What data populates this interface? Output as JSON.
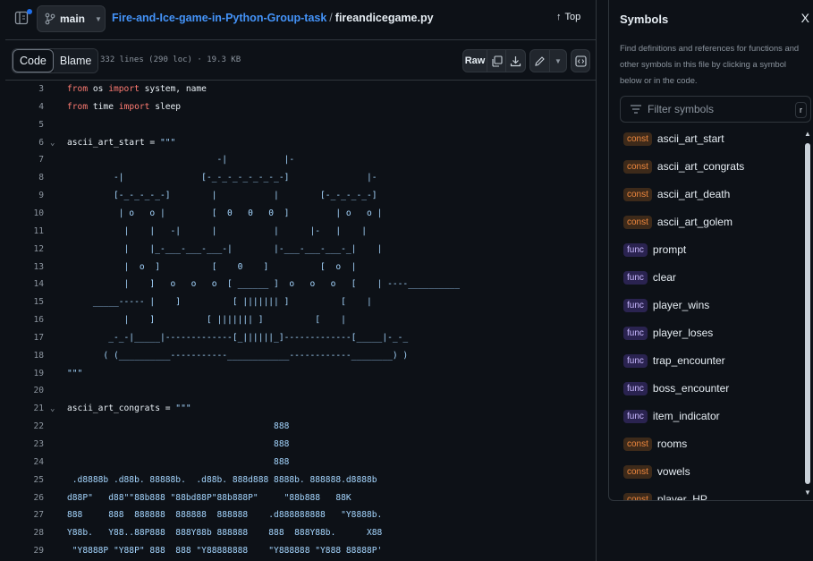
{
  "header": {
    "branch": "main",
    "repo_link": "Fire-and-Ice-game-in-Python-Group-task",
    "separator": "/",
    "file_name": "fireandicegame.py",
    "top_label": "Top"
  },
  "toolbar": {
    "code_tab": "Code",
    "blame_tab": "Blame",
    "file_meta": "332 lines (290 loc) · 19.3 KB",
    "raw_label": "Raw"
  },
  "code_lines": [
    {
      "n": "3",
      "fold": "",
      "html": "<span class=\"kw\">from</span> os <span class=\"kw\">import</span> system, name"
    },
    {
      "n": "4",
      "fold": "",
      "html": "<span class=\"kw\">from</span> time <span class=\"kw\">import</span> sleep"
    },
    {
      "n": "5",
      "fold": "",
      "html": ""
    },
    {
      "n": "6",
      "fold": "v",
      "html": "ascii_art_start = <span class=\"str\">\"\"\"</span>"
    },
    {
      "n": "7",
      "fold": "",
      "html": "<span class=\"str\">                             -|           |-</span>"
    },
    {
      "n": "8",
      "fold": "",
      "html": "<span class=\"str\">         -|               [-_-_-_-_-_-_-_-]               |-</span>"
    },
    {
      "n": "9",
      "fold": "",
      "html": "<span class=\"str\">         [-_-_-_-_-]        |           |        [-_-_-_-_-]</span>"
    },
    {
      "n": "10",
      "fold": "",
      "html": "<span class=\"str\">          | o   o |         [  0   0   0  ]         | o   o |</span>"
    },
    {
      "n": "11",
      "fold": "",
      "html": "<span class=\"str\">           |    |   -|      |           |      |-   |    |</span>"
    },
    {
      "n": "12",
      "fold": "",
      "html": "<span class=\"str\">           |    |_-___-___-___-|        |-___-___-___-_|    |</span>"
    },
    {
      "n": "13",
      "fold": "",
      "html": "<span class=\"str\">           |  o  ]          [    0    ]          [  o  |</span>"
    },
    {
      "n": "14",
      "fold": "",
      "html": "<span class=\"str\">           |    ]   o   o   o  [ ______ ]  o   o   o   [    | ----__________</span>"
    },
    {
      "n": "15",
      "fold": "",
      "html": "<span class=\"str\">     _____----- |    ]          [ ||||||| ]          [    |</span>"
    },
    {
      "n": "16",
      "fold": "",
      "html": "<span class=\"str\">           |    ]          [ ||||||| ]          [    |</span>"
    },
    {
      "n": "17",
      "fold": "",
      "html": "<span class=\"str\">        _-_-|_____|-------------[_||||||_]-------------[_____|-_-_</span>"
    },
    {
      "n": "18",
      "fold": "",
      "html": "<span class=\"str\">       ( (__________-----------____________------------________) )</span>"
    },
    {
      "n": "19",
      "fold": "",
      "html": "<span class=\"str\">\"\"\"</span>"
    },
    {
      "n": "20",
      "fold": "",
      "html": ""
    },
    {
      "n": "21",
      "fold": "v",
      "html": "ascii_art_congrats = <span class=\"str\">\"\"\"</span>"
    },
    {
      "n": "22",
      "fold": "",
      "html": "<span class=\"str\">                                        888</span>"
    },
    {
      "n": "23",
      "fold": "",
      "html": "<span class=\"str\">                                        888</span>"
    },
    {
      "n": "24",
      "fold": "",
      "html": "<span class=\"str\">                                        888</span>"
    },
    {
      "n": "25",
      "fold": "",
      "html": "<span class=\"str\"> .d8888b .d88b. 88888b.  .d88b. 888d888 8888b. 888888.d8888b</span>"
    },
    {
      "n": "26",
      "fold": "",
      "html": "<span class=\"str\">d88P\"   d88\"\"88b888 \"88bd88P\"88b888P\"     \"88b888   88K</span>"
    },
    {
      "n": "27",
      "fold": "",
      "html": "<span class=\"str\">888     888  888888  888888  888888    .d888888888   \"Y8888b.</span>"
    },
    {
      "n": "28",
      "fold": "",
      "html": "<span class=\"str\">Y88b.   Y88..88P888  888Y88b 888888    888  888Y88b.      X88</span>"
    },
    {
      "n": "29",
      "fold": "",
      "html": "<span class=\"str\"> \"Y8888P \"Y88P\" 888  888 \"Y88888888    \"Y888888 \"Y888 88888P'</span>"
    }
  ],
  "symbols": {
    "title": "Symbols",
    "close": "X",
    "description": "Find definitions and references for functions and other symbols in this file by clicking a symbol below or in the code.",
    "filter_placeholder": "Filter symbols",
    "filter_key": "r",
    "items": [
      {
        "kind": "const",
        "name": "ascii_art_start"
      },
      {
        "kind": "const",
        "name": "ascii_art_congrats"
      },
      {
        "kind": "const",
        "name": "ascii_art_death"
      },
      {
        "kind": "const",
        "name": "ascii_art_golem"
      },
      {
        "kind": "func",
        "name": "prompt"
      },
      {
        "kind": "func",
        "name": "clear"
      },
      {
        "kind": "func",
        "name": "player_wins"
      },
      {
        "kind": "func",
        "name": "player_loses"
      },
      {
        "kind": "func",
        "name": "trap_encounter"
      },
      {
        "kind": "func",
        "name": "boss_encounter"
      },
      {
        "kind": "func",
        "name": "item_indicator"
      },
      {
        "kind": "const",
        "name": "rooms"
      },
      {
        "kind": "const",
        "name": "vowels"
      },
      {
        "kind": "const",
        "name": "player_HP"
      }
    ]
  },
  "colors": {
    "background": "#0d1117",
    "accent": "#4493f8",
    "keyword": "#ff7b72",
    "string": "#a5d6ff",
    "const_badge": "#f0883e",
    "func_badge": "#c9b8ff"
  }
}
